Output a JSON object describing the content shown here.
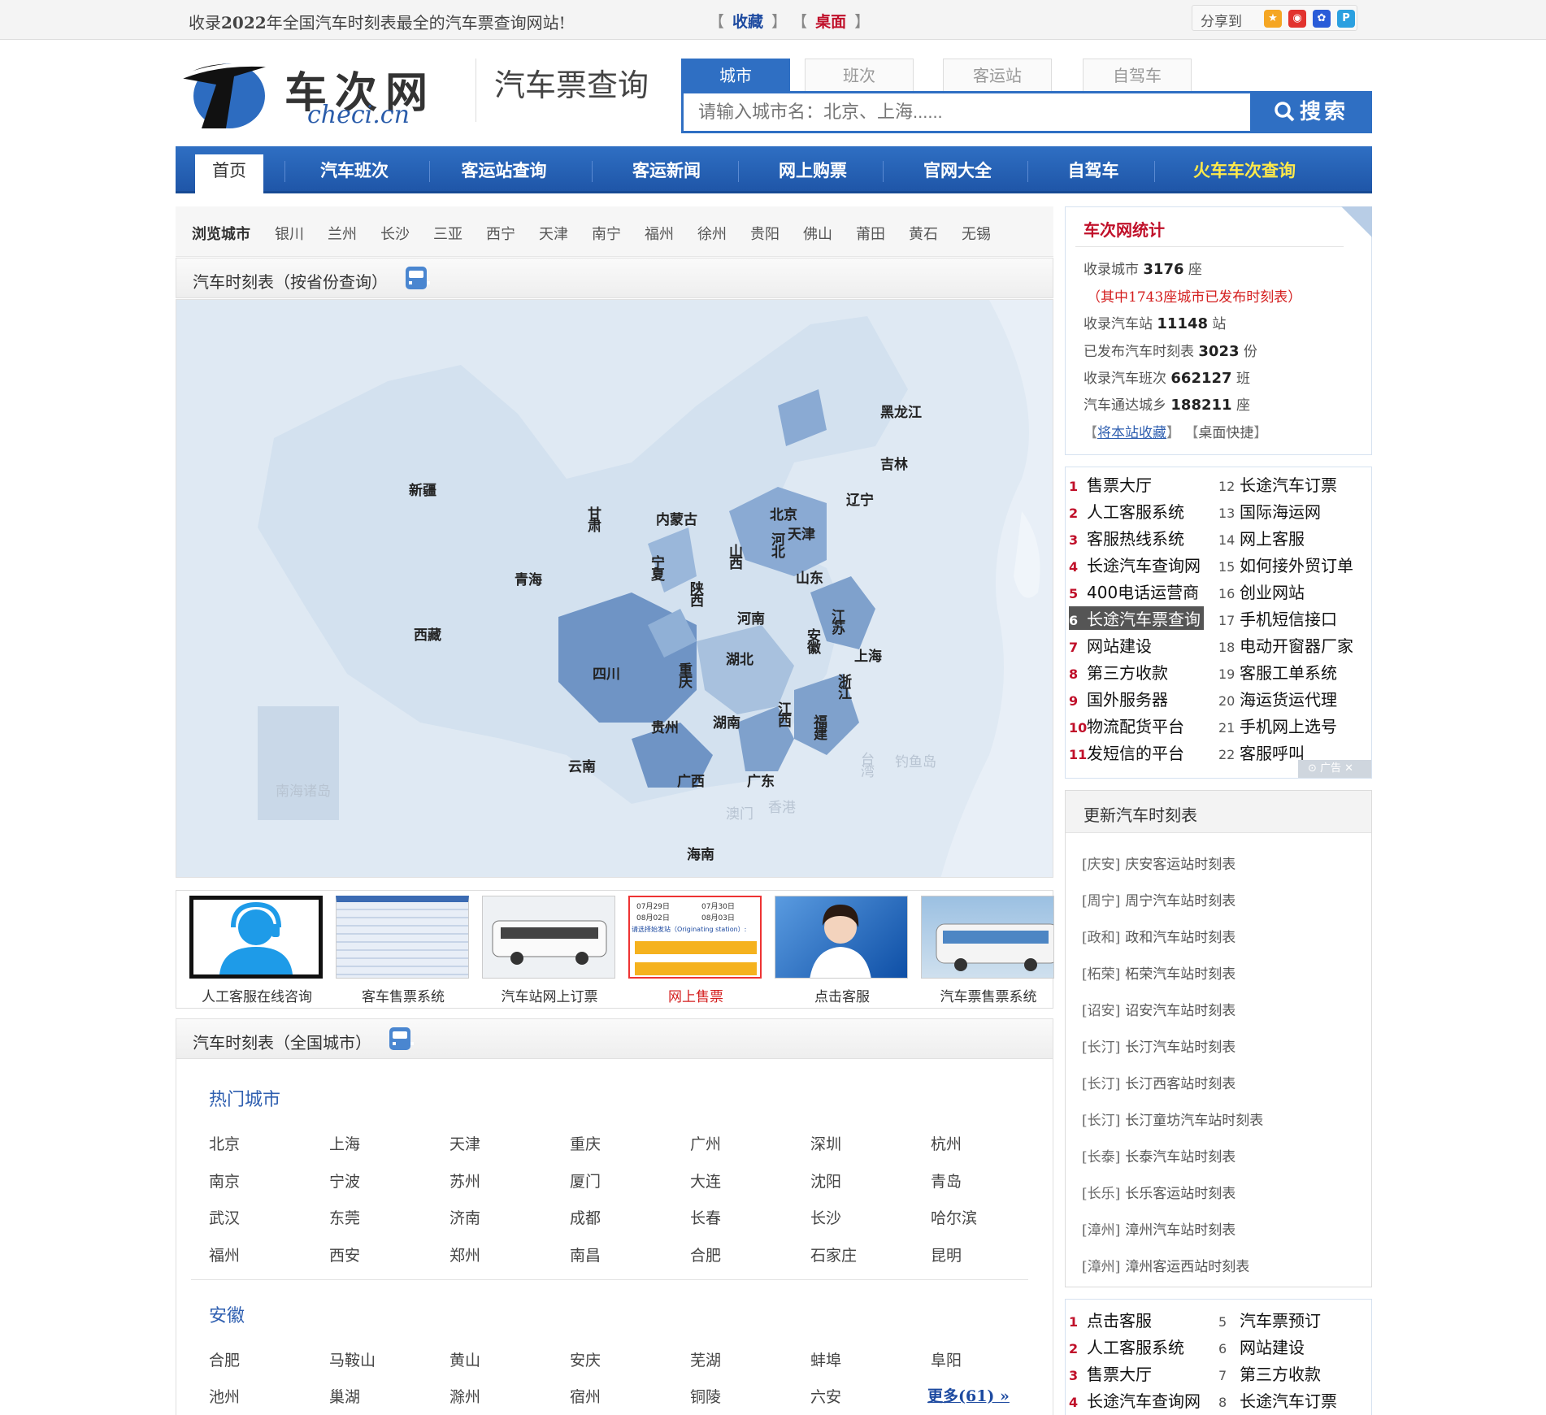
{
  "topbar": {
    "slogan_prefix": "收录",
    "slogan_year": "2022",
    "slogan_suffix": "年全国汽车时刻表最全的汽车票查询网站!",
    "bookmark": "收藏",
    "desktop": "桌面",
    "share_label": "分享到"
  },
  "share_icons": [
    {
      "name": "qzone-icon",
      "color": "#f5a623"
    },
    {
      "name": "weibo-icon",
      "color": "#e2332e"
    },
    {
      "name": "baidu-icon",
      "color": "#2a5cd8"
    },
    {
      "name": "qq-icon",
      "color": "#2ba0e0"
    }
  ],
  "logo": {
    "cn": "车次网",
    "en": "checi.cn"
  },
  "header": {
    "subtitle": "汽车票查询"
  },
  "search": {
    "tabs": [
      "城市",
      "班次",
      "客运站",
      "自驾车"
    ],
    "active_tab": 0,
    "placeholder": "请输入城市名：北京、上海......",
    "button": "搜索"
  },
  "nav": [
    "首页",
    "汽车班次",
    "客运站查询",
    "客运新闻",
    "网上购票",
    "官网大全",
    "自驾车",
    "火车车次查询"
  ],
  "browse": {
    "label": "浏览城市",
    "cities": [
      "银川",
      "兰州",
      "长沙",
      "三亚",
      "西宁",
      "天津",
      "南宁",
      "福州",
      "徐州",
      "贵阳",
      "佛山",
      "莆田",
      "黄石",
      "无锡"
    ]
  },
  "province_panel": {
    "title": "汽车时刻表（按省份查询）"
  },
  "map_labels": [
    "黑龙江",
    "吉林",
    "辽宁",
    "新疆",
    "内蒙古",
    "甘肃",
    "北京",
    "天津",
    "河北",
    "山西",
    "宁夏",
    "青海",
    "山东",
    "陕西",
    "河南",
    "江苏",
    "西藏",
    "安徽",
    "上海",
    "湖北",
    "四川",
    "重庆",
    "浙江",
    "贵州",
    "湖南",
    "江西",
    "福建",
    "台湾",
    "钓鱼岛",
    "云南",
    "广西",
    "广东",
    "香港",
    "澳门",
    "海南",
    "南海诸岛"
  ],
  "thumbs": [
    {
      "caption": "人工客服在线咨询"
    },
    {
      "caption": "客车售票系统"
    },
    {
      "caption": "汽车站网上订票"
    },
    {
      "caption": "网上售票",
      "dates": [
        "07月29日",
        "07月30日",
        "08月02日",
        "08月03日"
      ],
      "prompt": "请选择始发站（Originating station）:"
    },
    {
      "caption": "点击客服"
    },
    {
      "caption": "汽车票售票系统"
    }
  ],
  "all_cities_panel": {
    "title": "汽车时刻表（全国城市）"
  },
  "hot_cities": {
    "title": "热门城市",
    "cities": [
      "北京",
      "上海",
      "天津",
      "重庆",
      "广州",
      "深圳",
      "杭州",
      "南京",
      "宁波",
      "苏州",
      "厦门",
      "大连",
      "沈阳",
      "青岛",
      "武汉",
      "东莞",
      "济南",
      "成都",
      "长春",
      "长沙",
      "哈尔滨",
      "福州",
      "西安",
      "郑州",
      "南昌",
      "合肥",
      "石家庄",
      "昆明"
    ]
  },
  "anhui": {
    "title": "安徽",
    "cities": [
      "合肥",
      "马鞍山",
      "黄山",
      "安庆",
      "芜湖",
      "蚌埠",
      "阜阳",
      "池州",
      "巢湖",
      "滁州",
      "宿州",
      "铜陵",
      "六安"
    ],
    "more": "更多(61) »"
  },
  "stats": {
    "title": "车次网统计",
    "rows": [
      {
        "pre": "收录城市 ",
        "num": "3176",
        "post": " 座"
      },
      {
        "pre": "（其中1743座城市已发布时刻表）",
        "num": "",
        "post": "",
        "red": true
      },
      {
        "pre": "收录汽车站 ",
        "num": "11148",
        "post": " 站"
      },
      {
        "pre": "已发布汽车时刻表 ",
        "num": "3023",
        "post": " 份"
      },
      {
        "pre": "收录汽车班次 ",
        "num": "662127",
        "post": " 班"
      },
      {
        "pre": "汽车通达城乡 ",
        "num": "188211",
        "post": " 座"
      }
    ],
    "link1": "将本站收藏",
    "link2": "桌面快捷"
  },
  "ads1": {
    "left": [
      "售票大厅",
      "人工客服系统",
      "客服热线系统",
      "长途汽车查询网",
      "400电话运营商",
      "长途汽车票查询",
      "网站建设",
      "第三方收款",
      "国外服务器",
      "物流配货平台",
      "发短信的平台"
    ],
    "right": [
      "长途汽车订票",
      "国际海运网",
      "网上客服",
      "如何接外贸订单",
      "创业网站",
      "手机短信接口",
      "电动开窗器厂家",
      "客服工单系统",
      "海运货运代理",
      "手机网上选号",
      "客服呼叫"
    ],
    "selected": 5,
    "ad_label": "广告"
  },
  "updates": {
    "title": "更新汽车时刻表",
    "items": [
      {
        "tag": "[庆安]",
        "text": "庆安客运站时刻表"
      },
      {
        "tag": "[周宁]",
        "text": "周宁汽车站时刻表"
      },
      {
        "tag": "[政和]",
        "text": "政和汽车站时刻表"
      },
      {
        "tag": "[柘荣]",
        "text": "柘荣汽车站时刻表"
      },
      {
        "tag": "[诏安]",
        "text": "诏安汽车站时刻表"
      },
      {
        "tag": "[长汀]",
        "text": "长汀汽车站时刻表"
      },
      {
        "tag": "[长汀]",
        "text": "长汀西客站时刻表"
      },
      {
        "tag": "[长汀]",
        "text": "长汀童坊汽车站时刻表"
      },
      {
        "tag": "[长泰]",
        "text": "长泰汽车站时刻表"
      },
      {
        "tag": "[长乐]",
        "text": "长乐客运站时刻表"
      },
      {
        "tag": "[漳州]",
        "text": "漳州汽车站时刻表"
      },
      {
        "tag": "[漳州]",
        "text": "漳州客运西站时刻表"
      }
    ]
  },
  "ads2": {
    "left": [
      "点击客服",
      "人工客服系统",
      "售票大厅",
      "长途汽车查询网"
    ],
    "right": [
      "汽车票预订",
      "网站建设",
      "第三方收款",
      "长途汽车订票"
    ]
  }
}
